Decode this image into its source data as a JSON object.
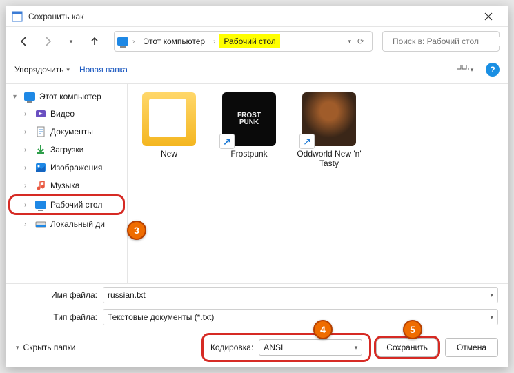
{
  "window": {
    "title": "Сохранить как"
  },
  "breadcrumb": {
    "seg1": "Этот компьютер",
    "seg2": "Рабочий стол"
  },
  "search": {
    "placeholder": "Поиск в: Рабочий стол"
  },
  "toolbar": {
    "organize": "Упорядочить",
    "new_folder": "Новая папка"
  },
  "sidebar": {
    "root": "Этот компьютер",
    "items": [
      "Видео",
      "Документы",
      "Загрузки",
      "Изображения",
      "Музыка",
      "Рабочий стол",
      "Локальный ди"
    ]
  },
  "files": [
    {
      "name": "New",
      "type": "folder"
    },
    {
      "name": "Frostpunk",
      "type": "shortcut",
      "thumb": "black",
      "thumb_text": "FROST\nPUNK"
    },
    {
      "name": "Oddworld New 'n' Tasty",
      "type": "shortcut",
      "thumb": "brown"
    }
  ],
  "form": {
    "filename_label": "Имя файла:",
    "filename_value": "russian.txt",
    "filetype_label": "Тип файла:",
    "filetype_value": "Текстовые документы (*.txt)",
    "encoding_label": "Кодировка:",
    "encoding_value": "ANSI"
  },
  "footer": {
    "hide_folders": "Скрыть папки",
    "save": "Сохранить",
    "cancel": "Отмена"
  },
  "badges": {
    "b3": "3",
    "b4": "4",
    "b5": "5"
  }
}
